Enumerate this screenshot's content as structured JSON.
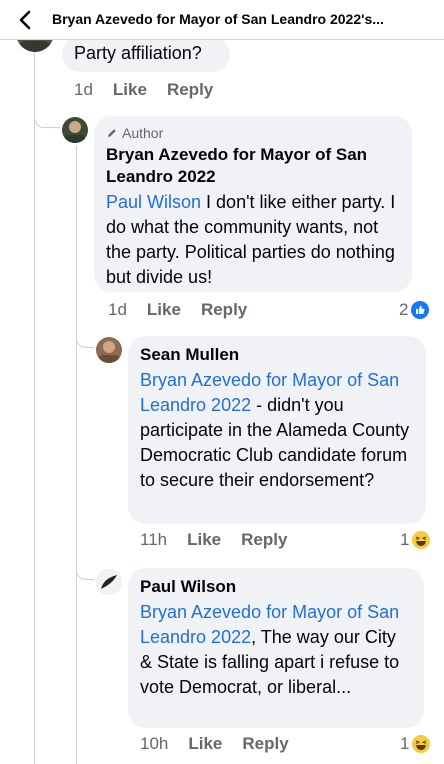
{
  "header": {
    "title": "Bryan Azevedo for Mayor of San Leandro 2022's..."
  },
  "comments": [
    {
      "text": "Party affiliation?",
      "time": "1d",
      "like": "Like",
      "reply": "Reply"
    },
    {
      "author_tag": "Author",
      "name": "Bryan Azevedo for Mayor of San Leandro 2022",
      "mention": "Paul Wilson",
      "text": " I don't like either party. I do what the community wants, not the party. Political parties do nothing but divide us!",
      "time": "1d",
      "like": "Like",
      "reply": "Reply",
      "reaction_count": "2",
      "reaction_icon": "like-icon"
    },
    {
      "name": "Sean Mullen",
      "mention": "Bryan Azevedo for Mayor of San Leandro 2022",
      "text": "  - didn't you participate in the Alameda County Democratic Club candidate forum to secure their endorsement?",
      "time": "11h",
      "like": "Like",
      "reply": "Reply",
      "reaction_count": "1",
      "reaction_icon": "haha-icon"
    },
    {
      "name": "Paul Wilson",
      "mention": "Bryan Azevedo for Mayor of San Leandro 2022",
      "text": ", The way our City & State is falling apart i refuse to vote Democrat, or liberal...",
      "time": "10h",
      "like": "Like",
      "reply": "Reply",
      "reaction_count": "1",
      "reaction_icon": "haha-icon"
    }
  ],
  "colors": {
    "link": "#216fdb",
    "bubble": "#f0f2f5",
    "meta": "#65676b",
    "like_blue": "#1877f2",
    "haha_yellow": "#f7c93e"
  }
}
